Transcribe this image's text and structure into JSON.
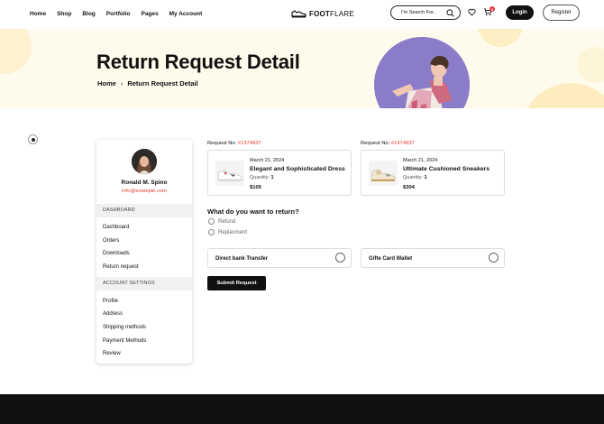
{
  "nav": {
    "items": [
      "Home",
      "Shop",
      "Blog",
      "Portfolio",
      "Pages",
      "My Account"
    ]
  },
  "logo": {
    "text_bold": "FOOT",
    "text_rest": "FLARE"
  },
  "search": {
    "placeholder": "I'm Search For.."
  },
  "cart": {
    "count": "0"
  },
  "auth": {
    "login_label": "Login",
    "register_label": "Register"
  },
  "hero": {
    "title": "Return Request Detail",
    "breadcrumb": {
      "home": "Home",
      "separator": "›",
      "current": "Return Request Detail"
    }
  },
  "profile": {
    "name": "Ronald M. Spino",
    "email": "info@example.com"
  },
  "sidebar": {
    "dashboard_heading": "DASHBOARD",
    "dashboard_items": [
      "Dashboard",
      "Orders",
      "Downloads",
      "Return request"
    ],
    "settings_heading": "ACCOUNT SETTINGS",
    "settings_items": [
      "Profile",
      "Address",
      "Shipping methods",
      "Payment Methods",
      "Review"
    ]
  },
  "requests": [
    {
      "label": "Request No:",
      "number": "#1374837",
      "date": "March 21, 2024",
      "name": "Elegant and Sophisticated Dress",
      "qty_label": "Quantity:",
      "qty": "1",
      "price": "$105"
    },
    {
      "label": "Request No:",
      "number": "#1374837",
      "date": "March 21, 2024",
      "name": "Ultimate Cushioned Sneakers",
      "qty_label": "Quantity:",
      "qty": "1",
      "price": "$304"
    }
  ],
  "return_form": {
    "question": "What do you want to return?",
    "options": [
      "Refund",
      "Replacment"
    ],
    "payment_methods": [
      "Direct bank Transfer",
      "Gifte Card Wallet"
    ],
    "submit_label": "Submit Request"
  },
  "colors": {
    "accent": "#e53935",
    "hero_bg": "#fffbec",
    "hero_photo_bg": "#8b7cc9",
    "dark": "#111111"
  }
}
